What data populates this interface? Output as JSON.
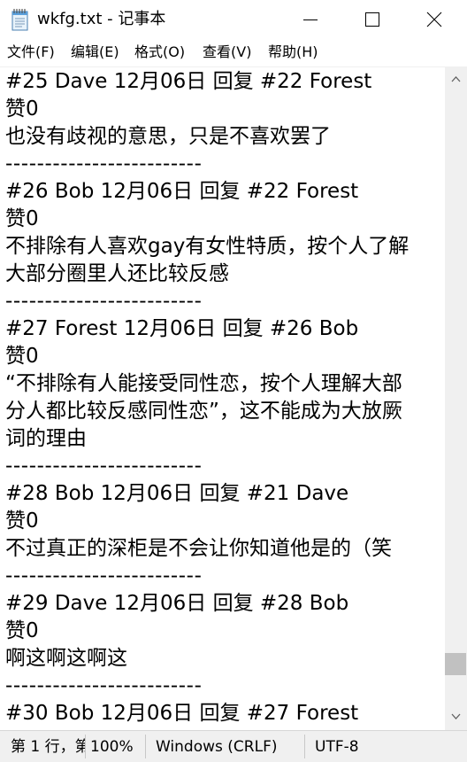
{
  "window": {
    "title": "wkfg.txt - 记事本",
    "icon": "notepad-icon"
  },
  "menu": {
    "file": "文件(F)",
    "edit": "编辑(E)",
    "format": "格式(O)",
    "view": "查看(V)",
    "help": "帮助(H)"
  },
  "editor": {
    "lines": [
      "#25 Dave 12月06日 回复 #22 Forest",
      "赞0",
      "也没有歧视的意思，只是不喜欢罢了",
      "-------------------------",
      "#26 Bob 12月06日 回复 #22 Forest",
      "赞0",
      "不排除有人喜欢gay有女性特质，按个人了解",
      "大部分圈里人还比较反感",
      "-------------------------",
      "#27 Forest 12月06日 回复 #26 Bob",
      "赞0",
      "“不排除有人能接受同性恋，按个人理解大部",
      "分人都比较反感同性恋”，这不能成为大放厥",
      "词的理由",
      "-------------------------",
      "#28 Bob 12月06日 回复 #21 Dave",
      "赞0",
      "不过真正的深柜是不会让你知道他是的（笑",
      "-------------------------",
      "#29 Dave 12月06日 回复 #28 Bob",
      "赞0",
      "啊这啊这啊这",
      "-------------------------",
      "#30 Bob 12月06日 回复 #27 Forest"
    ]
  },
  "status": {
    "position": "第 1 行，第",
    "zoom": "100%",
    "line_ending": "Windows (CRLF)",
    "encoding": "UTF-8"
  },
  "scroll": {
    "position_fraction": 0.93
  }
}
